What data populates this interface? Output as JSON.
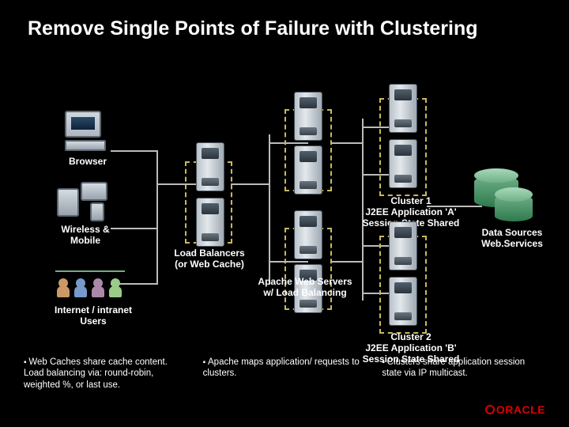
{
  "title": "Remove Single Points of Failure with Clustering",
  "labels": {
    "browser": "Browser",
    "wireless": "Wireless &\nMobile",
    "load_balancers": "Load Balancers\n(or Web Cache)",
    "apache": "Apache Web Servers\nw/ Load Balancing",
    "cluster1": "Cluster 1\nJ2EE Application 'A'\nSession State Shared",
    "cluster2": "Cluster 2\nJ2EE Application 'B'\nSession State Shared",
    "data_sources": "Data Sources\nWeb.Services",
    "internet_users": "Internet / intranet\nUsers"
  },
  "bullets": [
    "Web Caches share cache content. Load balancing via: round-robin, weighted %, or last use.",
    "Apache maps application/ requests to clusters.",
    "Clusters share application session state via IP multicast."
  ],
  "logo": "ORACLE"
}
